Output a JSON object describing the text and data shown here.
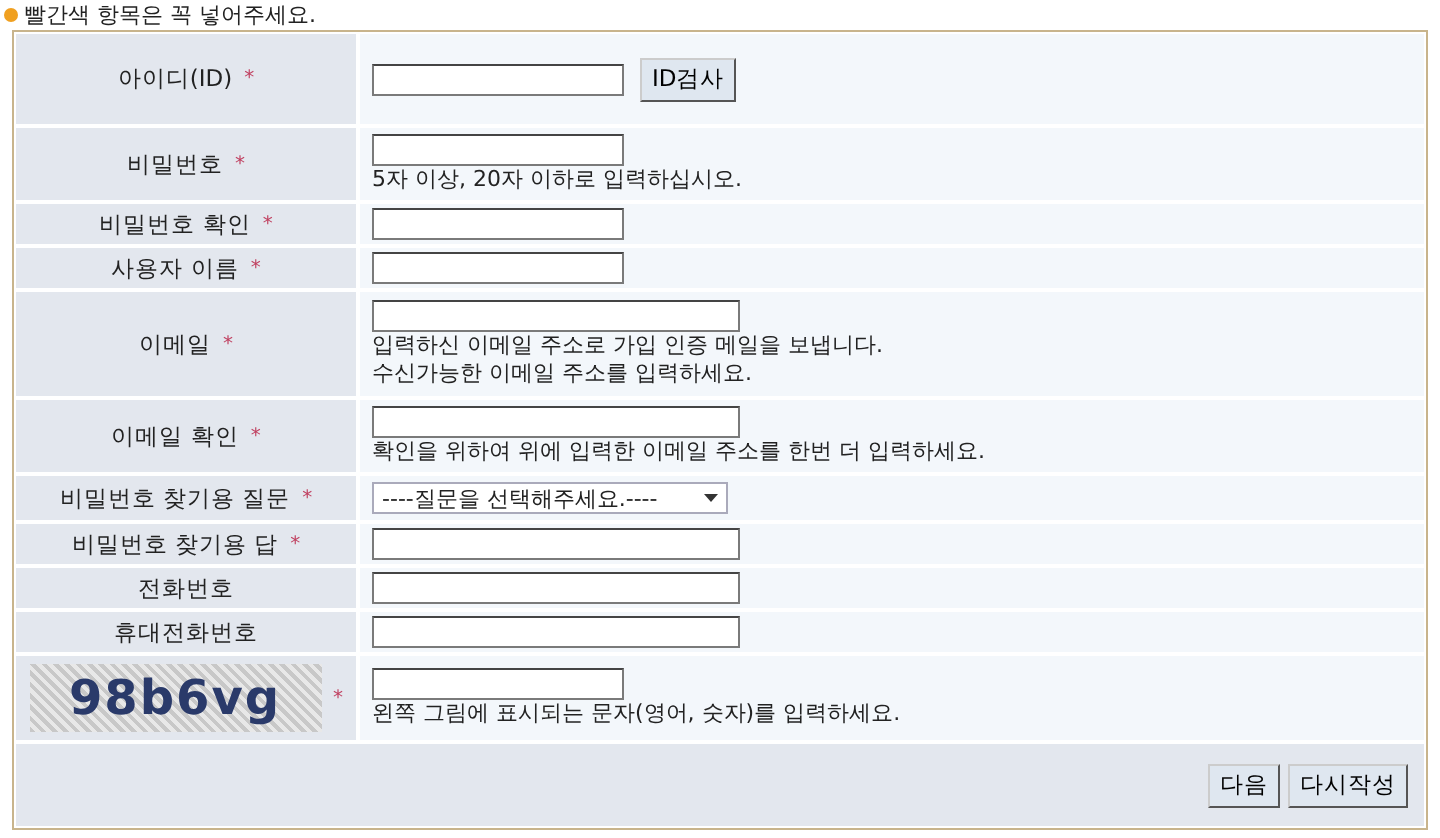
{
  "notice": "빨간색 항목은 꼭 넣어주세요.",
  "rows": [
    {
      "label": "아이디(ID)",
      "mark": "*",
      "kind": "short",
      "button": "ID검사",
      "hints": []
    },
    {
      "label": "비밀번호",
      "mark": "*",
      "kind": "short",
      "hints": [
        "5자 이상, 20자 이하로 입력하십시오."
      ]
    },
    {
      "label": "비밀번호 확인",
      "mark": "*",
      "kind": "short",
      "hints": []
    },
    {
      "label": "사용자 이름",
      "mark": "*",
      "kind": "short",
      "hints": []
    },
    {
      "label": "이메일",
      "mark": "*",
      "kind": "long",
      "hints": [
        "입력하신 이메일 주소로 가입 인증 메일을 보냅니다.",
        "수신가능한 이메일 주소를 입력하세요."
      ]
    },
    {
      "label": "이메일 확인",
      "mark": "*",
      "kind": "long",
      "hints": [
        "확인을 위하여 위에 입력한 이메일 주소를 한번 더 입력하세요."
      ]
    },
    {
      "label": "비밀번호 찾기용 질문",
      "mark": "*",
      "kind": "select",
      "value": "----질문을 선택해주세요.----",
      "hints": []
    },
    {
      "label": "비밀번호 찾기용 답",
      "mark": "*",
      "kind": "long",
      "hints": []
    },
    {
      "label": "전화번호",
      "kind": "long",
      "hints": []
    },
    {
      "label": "휴대전화번호",
      "kind": "long",
      "hints": []
    },
    {
      "label": "98b6vg",
      "mark": "*",
      "kind": "captcha",
      "hints": [
        "왼쪽 그림에 표시되는 문자(영어, 숫자)를 입력하세요."
      ]
    }
  ],
  "buttons": [
    "다음",
    "다시작성"
  ]
}
